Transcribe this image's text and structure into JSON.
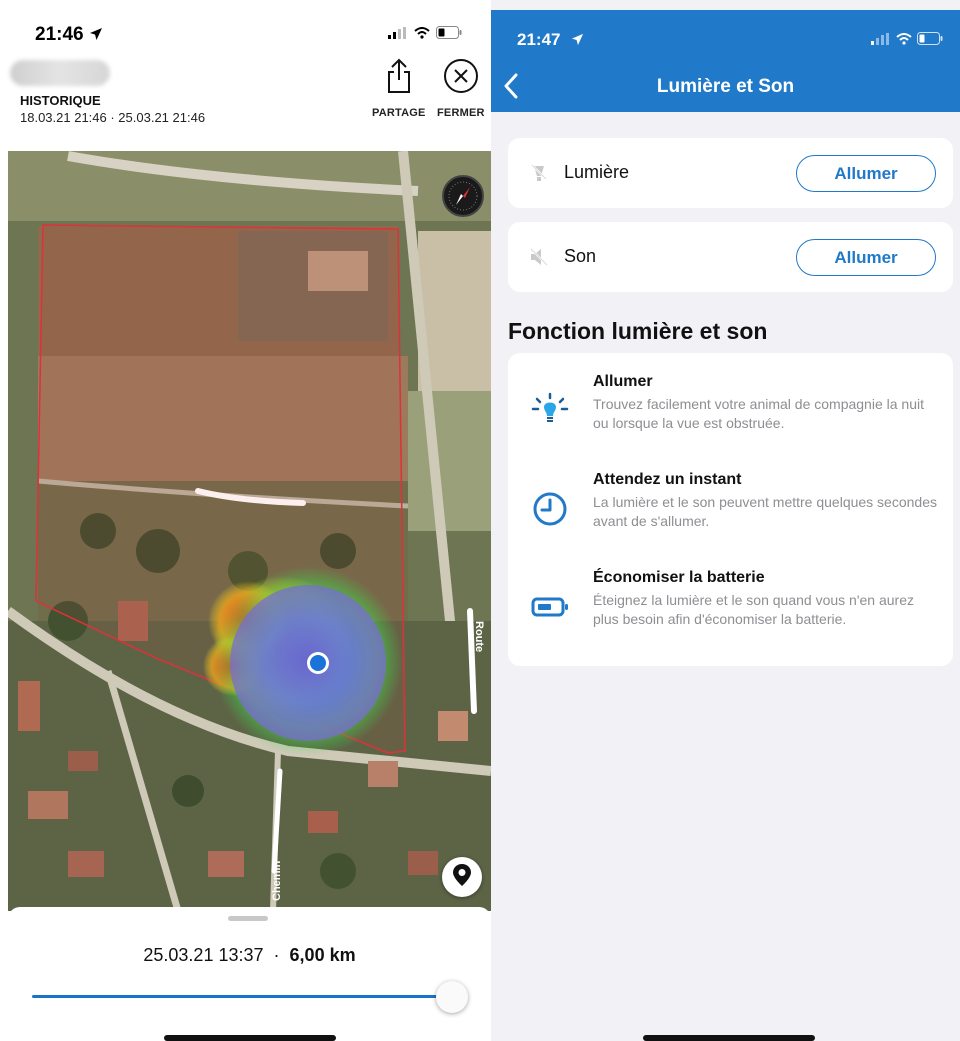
{
  "left": {
    "status": {
      "time": "21:46"
    },
    "history": {
      "title": "HISTORIQUE",
      "range": "18.03.21 21:46  ·  25.03.21 21:46"
    },
    "actions": {
      "share_label": "PARTAGE",
      "close_label": "FERMER"
    },
    "map": {
      "road_label_1": "Route",
      "road_label_2": "Chemin"
    },
    "sheet": {
      "timestamp": "25.03.21 13:37",
      "separator": "·",
      "distance": "6,00 km"
    },
    "slider": {
      "progress": 1.0
    }
  },
  "right": {
    "status": {
      "time": "21:47"
    },
    "header": {
      "title": "Lumière et Son"
    },
    "controls": [
      {
        "label": "Lumière",
        "button": "Allumer",
        "icon": "bulb-icon"
      },
      {
        "label": "Son",
        "button": "Allumer",
        "icon": "speaker-muted-icon"
      }
    ],
    "section_title": "Fonction lumière et son",
    "features": [
      {
        "title": "Allumer",
        "desc": "Trouvez facilement votre animal de compagnie la nuit ou lorsque la vue est obstruée.",
        "icon": "lightbulb-icon"
      },
      {
        "title": "Attendez un instant",
        "desc": "La lumière et le son peuvent mettre quelques secondes avant de s'allumer.",
        "icon": "clock-icon"
      },
      {
        "title": "Économiser la batterie",
        "desc": "Éteignez la lumière et le son quand vous n'en aurez plus besoin afin d'économiser la batterie.",
        "icon": "battery-icon"
      }
    ]
  },
  "colors": {
    "accent": "#2179c9",
    "background": "#f2f2f6",
    "zone": "#e0303a"
  }
}
